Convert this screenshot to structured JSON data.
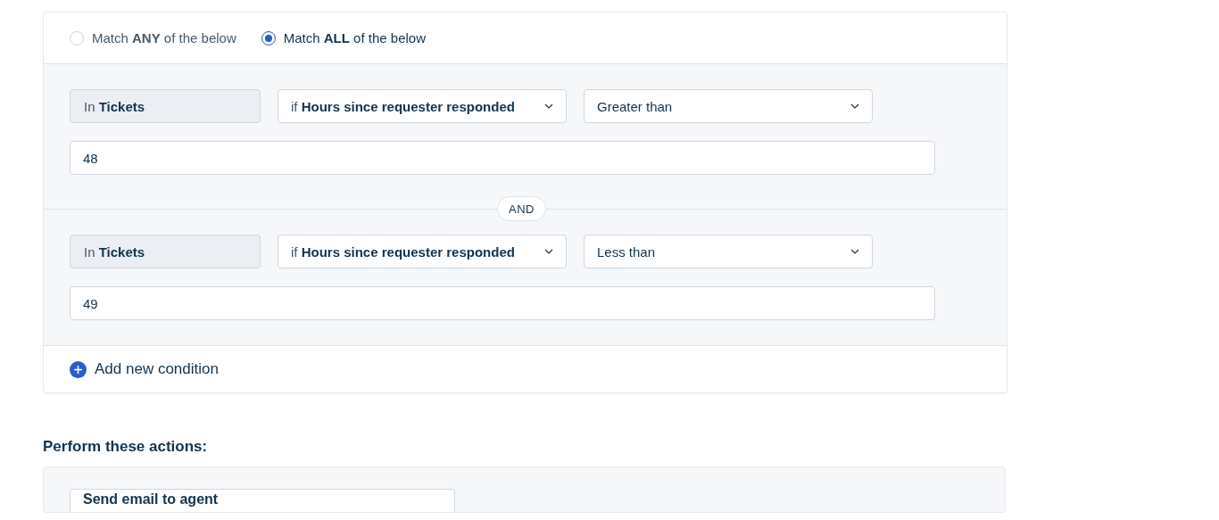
{
  "match_options": [
    {
      "label": "Match **ANY** of the below",
      "selected": false
    },
    {
      "label": "Match **ALL** of the below",
      "selected": true
    }
  ],
  "conditions": [
    {
      "scope": "In **Tickets**",
      "field": "if **Hours since requester responded**",
      "operator": "Greater than",
      "value": "48"
    },
    {
      "scope": "In **Tickets**",
      "field": "if **Hours since requester responded**",
      "operator": "Less than",
      "value": "49"
    }
  ],
  "joiner": "AND",
  "add_condition": "Add new condition",
  "actions_heading": "Perform these actions:",
  "actions": [
    {
      "label": "Send email to agent"
    }
  ]
}
